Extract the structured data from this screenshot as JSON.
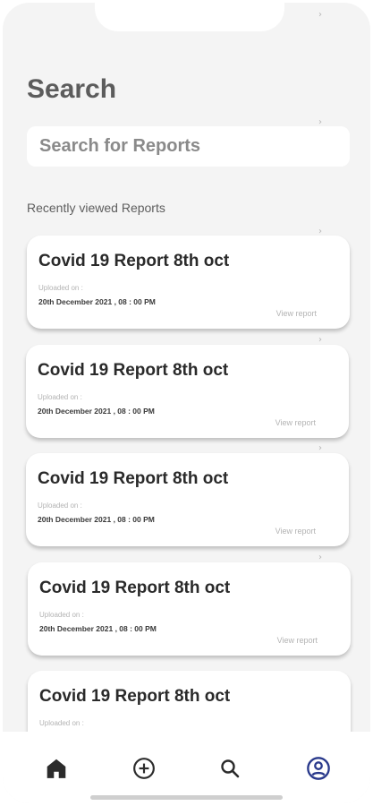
{
  "page": {
    "title": "Search"
  },
  "search": {
    "placeholder": "Search for Reports"
  },
  "section": {
    "heading": "Recently viewed Reports"
  },
  "reports": [
    {
      "title": "Covid 19 Report 8th oct",
      "uploaded_label": "Uploaded on :",
      "date": "20th December 2021 , 08 : 00 PM",
      "action": "View report"
    },
    {
      "title": "Covid 19 Report 8th oct",
      "uploaded_label": "Uploaded on :",
      "date": "20th December 2021 , 08 : 00 PM",
      "action": "View report"
    },
    {
      "title": "Covid 19 Report 8th oct",
      "uploaded_label": "Uploaded on :",
      "date": "20th December 2021 , 08 : 00 PM",
      "action": "View report"
    },
    {
      "title": "Covid 19 Report 8th oct",
      "uploaded_label": "Uploaded on :",
      "date": "20th December 2021 , 08 : 00 PM",
      "action": "View report"
    },
    {
      "title": "Covid 19 Report 8th oct",
      "uploaded_label": "Uploaded on :"
    }
  ],
  "nav": {
    "items": [
      {
        "icon": "home-icon",
        "active": true
      },
      {
        "icon": "add-circle-icon",
        "active": false
      },
      {
        "icon": "search-icon",
        "active": false
      },
      {
        "icon": "profile-icon",
        "active": false
      }
    ]
  },
  "colors": {
    "background": "#f4f4f4",
    "card": "#ffffff",
    "text_dark": "#2a2a2a",
    "muted": "#b3b3b3"
  }
}
